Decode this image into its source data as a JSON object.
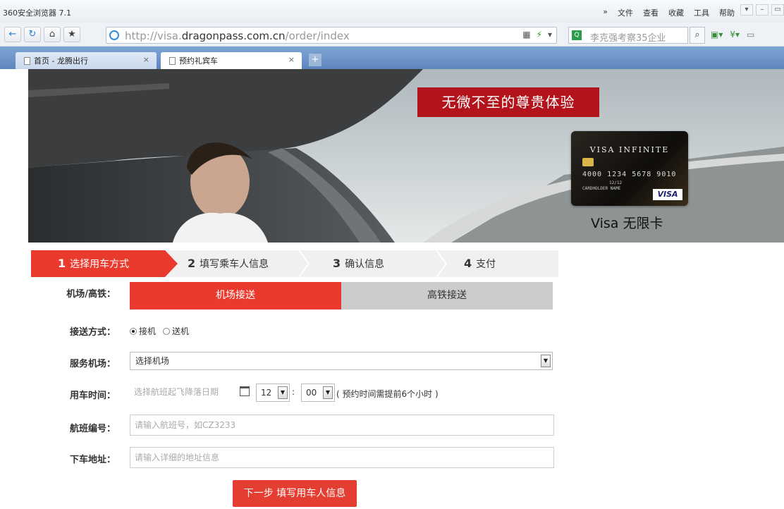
{
  "browser": {
    "app_title": "360安全浏览器 7.1",
    "menu": [
      "»",
      "文件",
      "查看",
      "收藏",
      "工具",
      "帮助"
    ],
    "url_prefix": "http://visa.",
    "url_domain": "dragonpass.com.cn",
    "url_path": "/order/index",
    "search_placeholder": "李克强考察35企业",
    "tabs": [
      {
        "label": "首页 - 龙腾出行",
        "active": false
      },
      {
        "label": "预约礼宾车",
        "active": true
      }
    ]
  },
  "banner": {
    "tagline": "无微不至的尊贵体验",
    "card_brand": "VISA INFINITE",
    "card_number": "4000 1234 5678 9010",
    "card_expiry": "12/12",
    "card_holder": "CARDHOLDER NAME",
    "card_logo": "VISA",
    "caption": "Visa 无限卡"
  },
  "steps": [
    {
      "num": "1",
      "label": "选择用车方式",
      "active": true
    },
    {
      "num": "2",
      "label": "填写乘车人信息",
      "active": false
    },
    {
      "num": "3",
      "label": "确认信息",
      "active": false
    },
    {
      "num": "4",
      "label": "支付",
      "active": false
    }
  ],
  "form": {
    "transfer_type_label": "机场/高铁：",
    "transfer_tabs": [
      {
        "label": "机场接送",
        "active": true
      },
      {
        "label": "高铁接送",
        "active": false
      }
    ],
    "mode_label": "接送方式：",
    "mode_options": [
      {
        "label": "接机",
        "checked": true
      },
      {
        "label": "送机",
        "checked": false
      }
    ],
    "airport_label": "服务机场：",
    "airport_value": "选择机场",
    "time_label": "用车时间：",
    "date_placeholder": "选择航班起飞降落日期",
    "hour": "12",
    "minute": "00",
    "time_note": "( 预约时间需提前6个小时 )",
    "flight_label": "航班编号：",
    "flight_placeholder": "请输入航班号，如CZ3233",
    "address_label": "下车地址：",
    "address_placeholder": "请输入详细的地址信息",
    "submit_label": "下一步 填写用车人信息"
  },
  "colors": {
    "accent": "#ea3a2e",
    "banner_red": "#b3141b"
  }
}
